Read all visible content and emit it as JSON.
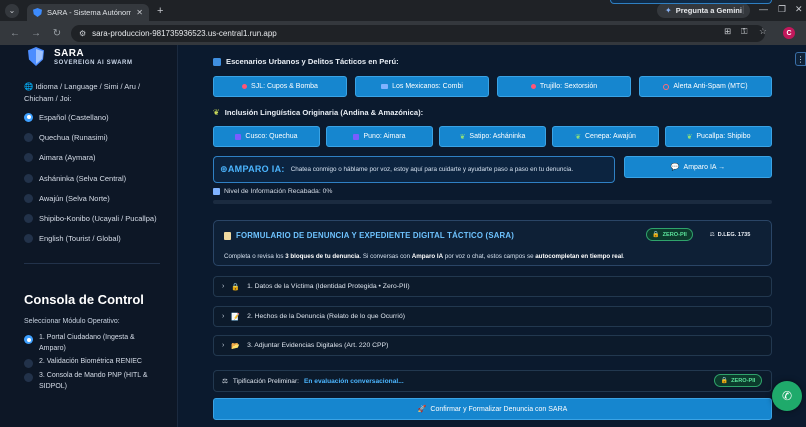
{
  "browser": {
    "tab_title": "SARA - Sistema Autónomo de",
    "url": "sara-produccion-981735936523.us-central1.run.app",
    "gemini_label": "Pregunta a Gemini",
    "profile_initial": "C"
  },
  "sidebar": {
    "brand": "SARA",
    "tagline": "SOVEREIGN AI SWARM",
    "language_label": "🌐 Idioma / Language / Simi / Aru / Chicham / Joi:",
    "languages": [
      {
        "label": "Español (Castellano)",
        "selected": true
      },
      {
        "label": "Quechua (Runasimi)",
        "selected": false
      },
      {
        "label": "Aimara (Aymara)",
        "selected": false
      },
      {
        "label": "Asháninka (Selva Central)",
        "selected": false
      },
      {
        "label": "Awajún (Selva Norte)",
        "selected": false
      },
      {
        "label": "Shipibo-Konibo (Ucayali / Pucallpa)",
        "selected": false
      },
      {
        "label": "English (Tourist / Global)",
        "selected": false
      }
    ],
    "console_title": "Consola de Control",
    "module_label": "Seleccionar Módulo Operativo:",
    "modules": [
      {
        "label": "1. Portal Ciudadano (Ingesta & Amparo)",
        "selected": true
      },
      {
        "label": "2. Validación Biométrica RENIEC",
        "selected": false
      },
      {
        "label": "3. Consola de Mando PNP (HITL & SIDPOL)",
        "selected": false
      }
    ]
  },
  "main": {
    "urban_title": "Escenarios Urbanos y Delitos Tácticos en Perú:",
    "urban_buttons": [
      "SJL: Cupos & Bomba",
      "Los Mexicanos: Combi",
      "Trujillo: Sextorsión",
      "Alerta Anti-Spam (MTC)"
    ],
    "linguistic_title": "Inclusión Lingüística Originaria (Andina & Amazónica):",
    "linguistic_buttons": [
      "Cusco: Quechua",
      "Puno: Aimara",
      "Satipo: Asháninka",
      "Cenepa: Awajún",
      "Pucallpa: Shipibo"
    ],
    "amparo": {
      "title": "AMPARO IA:",
      "description": "Chatea conmigo o háblame por voz, estoy aquí para cuidarte y ayudarte paso a paso en tu denuncia.",
      "button": "Amparo IA →"
    },
    "info_level": "Nivel de Información Recabada: 0%",
    "info_progress": 0,
    "form": {
      "title": "FORMULARIO DE DENUNCIA Y EXPEDIENTE DIGITAL TÁCTICO (SARA)",
      "badge_zero_pii": "ZERO-PII",
      "badge_leg": "D.LEG. 1735",
      "desc_1": "Completa o revisa los ",
      "desc_2": "3 bloques de tu denuncia",
      "desc_3": ". Si conversas con ",
      "desc_4": "Amparo IA",
      "desc_5": " por voz o chat, estos campos se ",
      "desc_6": "autocompletan en tiempo real",
      "desc_7": "."
    },
    "sections": [
      "1. Datos de la Víctima (Identidad Protegida • Zero-PII)",
      "2. Hechos de la Denuncia (Relato de lo que Ocurrió)",
      "3. Adjuntar Evidencias Digitales (Art. 220 CPP)"
    ],
    "tipificacion_label": "Tipificación Preliminar:",
    "tipificacion_status": "En evaluación conversacional...",
    "tipificacion_badge": "ZERO-PII",
    "confirm_button": "Confirmar y Formalizar Denuncia con SARA"
  },
  "colors": {
    "accent": "#1686cf",
    "background": "#0b1a2e",
    "success": "#1faa6b"
  }
}
